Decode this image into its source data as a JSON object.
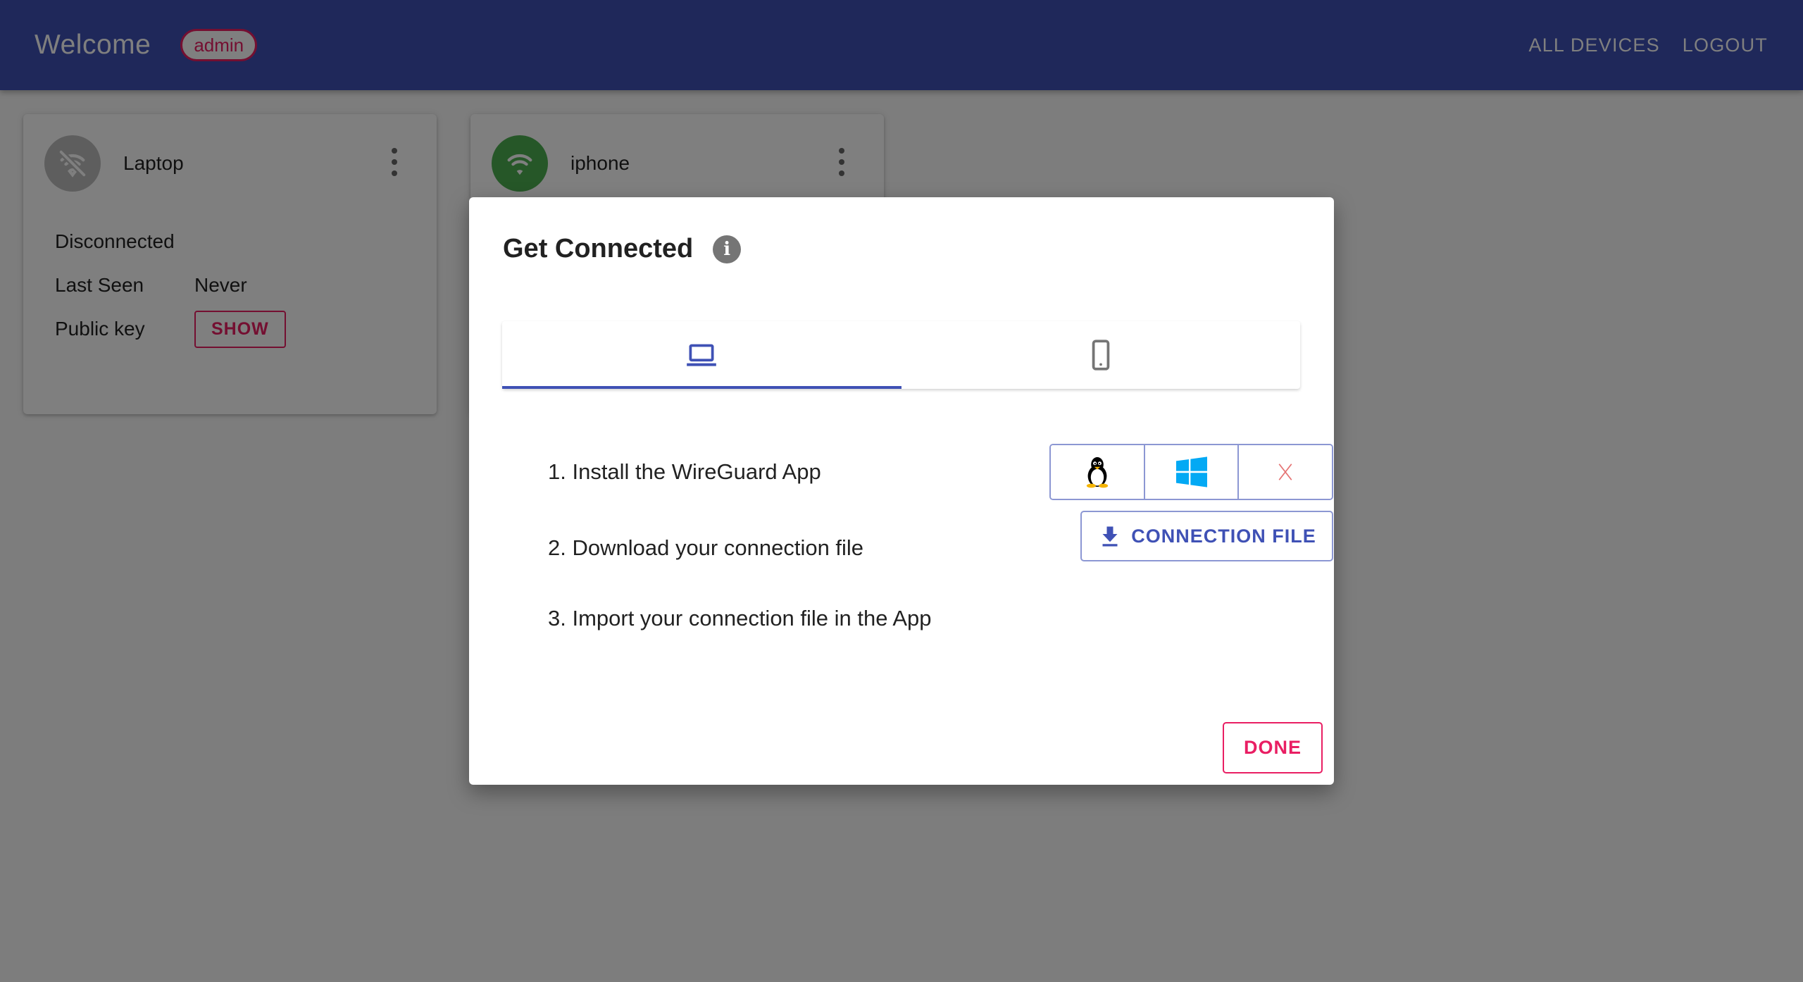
{
  "header": {
    "title": "Welcome",
    "user_badge": "admin",
    "nav": {
      "all_devices": "ALL DEVICES",
      "logout": "LOGOUT"
    }
  },
  "devices": [
    {
      "name": "Laptop",
      "icon": "wifi-off-icon",
      "status": "Disconnected",
      "last_seen_label": "Last Seen",
      "last_seen_value": "Never",
      "public_key_label": "Public key",
      "show_label": "SHOW"
    },
    {
      "name": "iphone",
      "icon": "wifi-icon"
    }
  ],
  "dialog": {
    "title": "Get Connected",
    "tabs": [
      {
        "icon": "laptop-icon",
        "active": true
      },
      {
        "icon": "smartphone-icon",
        "active": false
      }
    ],
    "steps": {
      "step1": "1. Install the WireGuard App",
      "step2": "2. Download your connection file",
      "step3": "3. Import your connection file in the App"
    },
    "os_buttons": [
      "linux-icon",
      "windows-icon",
      "macos-icon"
    ],
    "connection_file_label": "CONNECTION FILE",
    "done_label": "DONE"
  },
  "colors": {
    "primary": "#3f51b5",
    "accent": "#e91e63",
    "online": "#4caf50",
    "offline": "#bdbdbd"
  }
}
